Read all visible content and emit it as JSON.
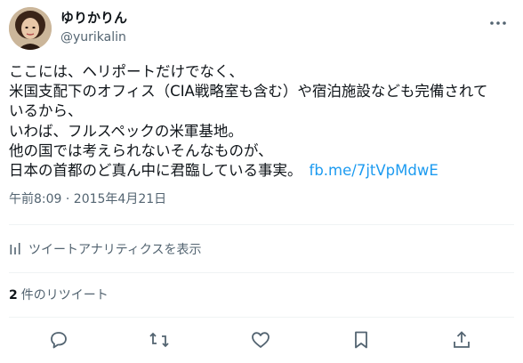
{
  "user": {
    "display_name": "ゆりかりん",
    "handle": "@yurikalin"
  },
  "tweet": {
    "text": "ここには、ヘリポートだけでなく、\n米国支配下のオフィス（CIA戦略室も含む）や宿泊施設なども完備されて\nいるから、\nいわば、フルスペックの米軍基地。\n他の国では考えられないそんなものが、\n日本の首都のど真ん中に君臨している事実。",
    "link": "fb.me/7jtVpMdwE",
    "timestamp": "午前8:09 · 2015年4月21日"
  },
  "analytics": {
    "label": "ツイートアナリティクスを表示"
  },
  "stats": {
    "retweet_count": "2",
    "retweet_label": "件のリツイート"
  },
  "icons": {
    "more": "more-icon",
    "analytics": "bar-chart-icon",
    "reply": "reply-icon",
    "retweet": "retweet-icon",
    "like": "heart-icon",
    "bookmark": "bookmark-icon",
    "share": "share-icon"
  },
  "colors": {
    "text": "#0f1419",
    "secondary": "#536471",
    "link": "#1d9bf0",
    "divider": "#eff3f4"
  }
}
